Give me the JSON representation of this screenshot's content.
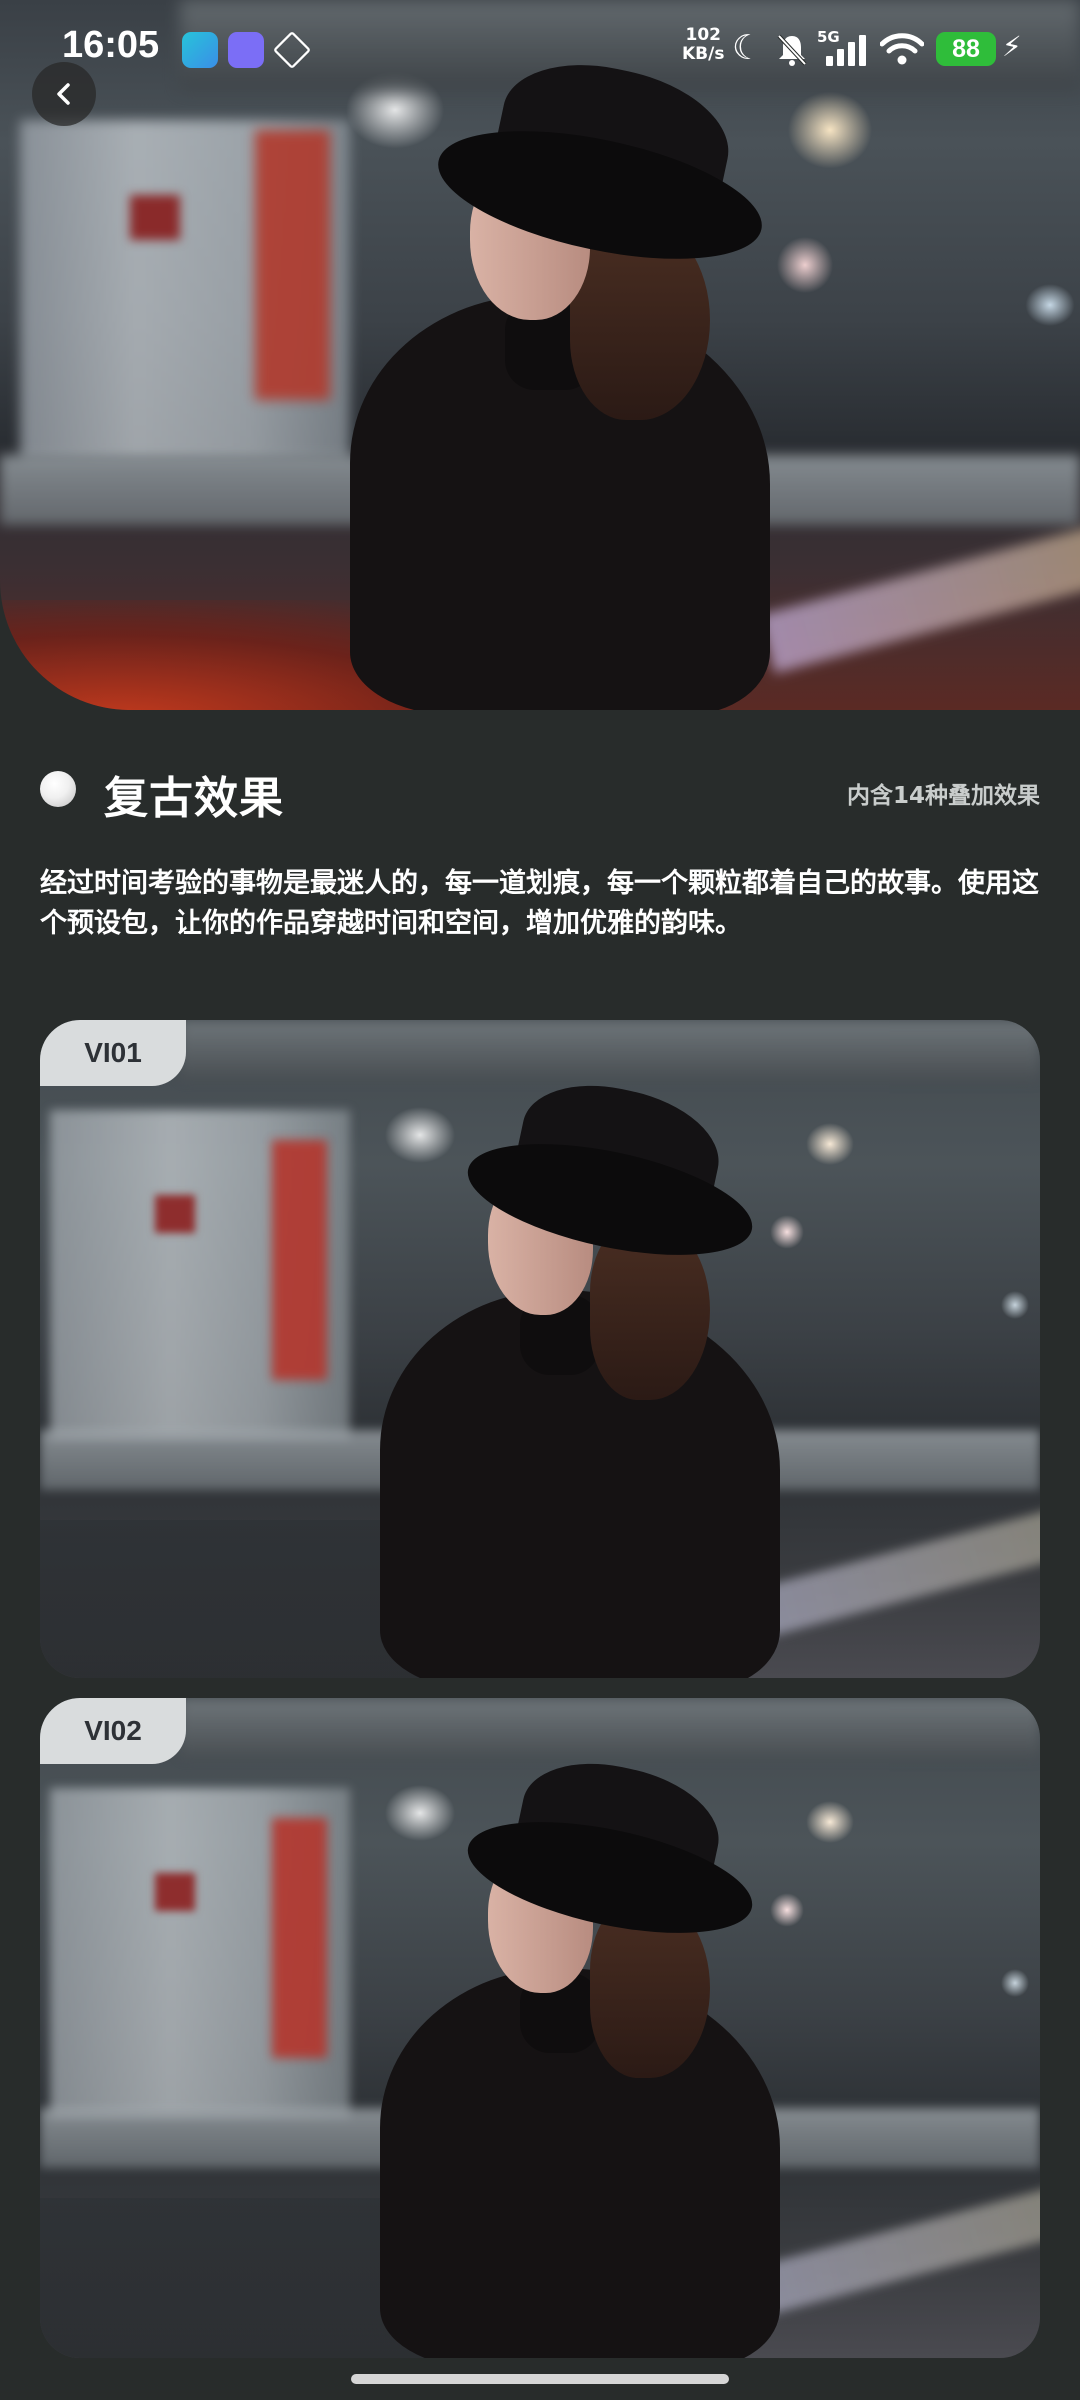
{
  "status_bar": {
    "time": "16:05",
    "speed_value": "102",
    "speed_unit": "KB/s",
    "network": "5G",
    "battery": "88"
  },
  "header": {
    "back_icon": "chevron-left-icon"
  },
  "section": {
    "title": "复古效果",
    "subtitle": "内含14种叠加效果",
    "description": "经过时间考验的事物是最迷人的，每一道划痕，每一个颗粒都着自己的故事。使用这个预设包，让你的作品穿越时间和空间，增加优雅的韵味。"
  },
  "presets": [
    {
      "label": "VI01"
    },
    {
      "label": "VI02"
    }
  ],
  "colors": {
    "background": "#282c2b",
    "label_bg": "#d9dcdd",
    "battery_green": "#2fbd3a"
  }
}
